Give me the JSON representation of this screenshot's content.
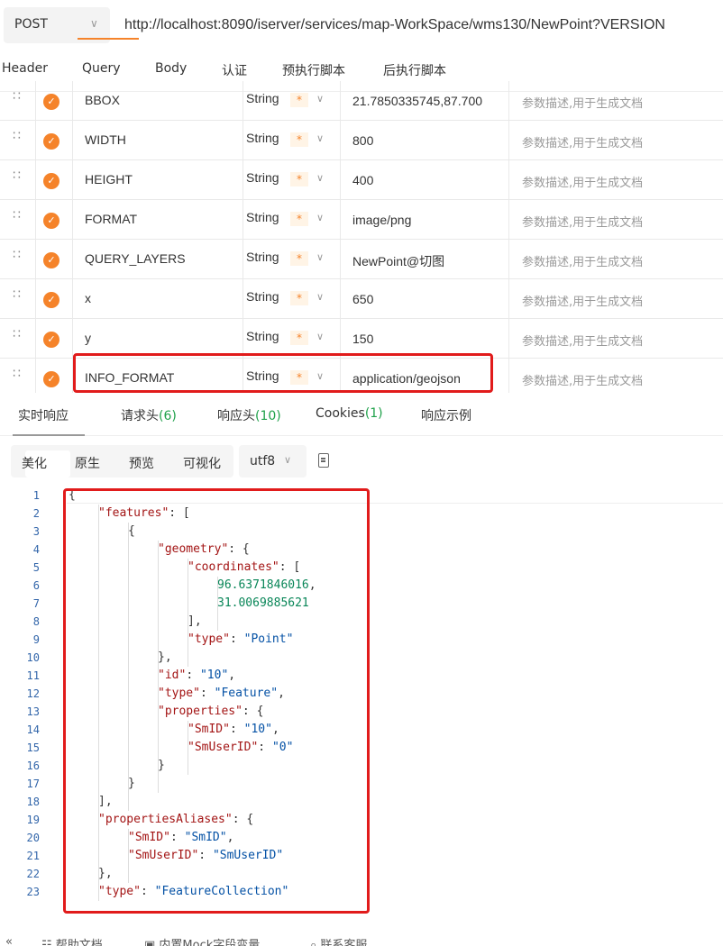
{
  "request": {
    "method": "POST",
    "url": "http://localhost:8090/iserver/services/map-WorkSpace/wms130/NewPoint?VERSION"
  },
  "request_tabs": [
    "Header",
    "Query",
    "Body",
    "认证",
    "预执行脚本",
    "后执行脚本"
  ],
  "active_request_tab": "Query",
  "params": [
    {
      "key": "BBOX",
      "type": "String",
      "required": "*",
      "value": "21.7850335745,87.700",
      "description": "参数描述,用于生成文档"
    },
    {
      "key": "WIDTH",
      "type": "String",
      "required": "*",
      "value": "800",
      "description": "参数描述,用于生成文档"
    },
    {
      "key": "HEIGHT",
      "type": "String",
      "required": "*",
      "value": "400",
      "description": "参数描述,用于生成文档"
    },
    {
      "key": "FORMAT",
      "type": "String",
      "required": "*",
      "value": "image/png",
      "description": "参数描述,用于生成文档"
    },
    {
      "key": "QUERY_LAYERS",
      "type": "String",
      "required": "*",
      "value": "NewPoint@切图",
      "description": "参数描述,用于生成文档"
    },
    {
      "key": "x",
      "type": "String",
      "required": "*",
      "value": "650",
      "description": "参数描述,用于生成文档"
    },
    {
      "key": "y",
      "type": "String",
      "required": "*",
      "value": "150",
      "description": "参数描述,用于生成文档"
    },
    {
      "key": "INFO_FORMAT",
      "type": "String",
      "required": "*",
      "value": "application/geojson",
      "description": "参数描述,用于生成文档"
    }
  ],
  "response_tabs": [
    {
      "label": "实时响应",
      "count": ""
    },
    {
      "label": "请求头",
      "count": "(6)"
    },
    {
      "label": "响应头",
      "count": "(10)"
    },
    {
      "label": "Cookies",
      "count": "(1)"
    },
    {
      "label": "响应示例",
      "count": ""
    }
  ],
  "view_modes": [
    "美化",
    "原生",
    "预览",
    "可视化"
  ],
  "encoding": "utf8",
  "code_lines": [
    {
      "n": "1",
      "indent": 0,
      "parts": [
        [
          "p",
          "{"
        ]
      ]
    },
    {
      "n": "2",
      "indent": 1,
      "parts": [
        [
          "k",
          "\"features\""
        ],
        [
          "p",
          ": ["
        ]
      ]
    },
    {
      "n": "3",
      "indent": 2,
      "parts": [
        [
          "p",
          "{"
        ]
      ]
    },
    {
      "n": "4",
      "indent": 3,
      "parts": [
        [
          "k",
          "\"geometry\""
        ],
        [
          "p",
          ": {"
        ]
      ]
    },
    {
      "n": "5",
      "indent": 4,
      "parts": [
        [
          "k",
          "\"coordinates\""
        ],
        [
          "p",
          ": ["
        ]
      ]
    },
    {
      "n": "6",
      "indent": 5,
      "parts": [
        [
          "n",
          "96.6371846016"
        ],
        [
          "p",
          ","
        ]
      ]
    },
    {
      "n": "7",
      "indent": 5,
      "parts": [
        [
          "n",
          "31.0069885621"
        ]
      ]
    },
    {
      "n": "8",
      "indent": 4,
      "parts": [
        [
          "p",
          "],"
        ]
      ]
    },
    {
      "n": "9",
      "indent": 4,
      "parts": [
        [
          "k",
          "\"type\""
        ],
        [
          "p",
          ": "
        ],
        [
          "s",
          "\"Point\""
        ]
      ]
    },
    {
      "n": "10",
      "indent": 3,
      "parts": [
        [
          "p",
          "},"
        ]
      ]
    },
    {
      "n": "11",
      "indent": 3,
      "parts": [
        [
          "k",
          "\"id\""
        ],
        [
          "p",
          ": "
        ],
        [
          "s",
          "\"10\""
        ],
        [
          "p",
          ","
        ]
      ]
    },
    {
      "n": "12",
      "indent": 3,
      "parts": [
        [
          "k",
          "\"type\""
        ],
        [
          "p",
          ": "
        ],
        [
          "s",
          "\"Feature\""
        ],
        [
          "p",
          ","
        ]
      ]
    },
    {
      "n": "13",
      "indent": 3,
      "parts": [
        [
          "k",
          "\"properties\""
        ],
        [
          "p",
          ": {"
        ]
      ]
    },
    {
      "n": "14",
      "indent": 4,
      "parts": [
        [
          "k",
          "\"SmID\""
        ],
        [
          "p",
          ": "
        ],
        [
          "s",
          "\"10\""
        ],
        [
          "p",
          ","
        ]
      ]
    },
    {
      "n": "15",
      "indent": 4,
      "parts": [
        [
          "k",
          "\"SmUserID\""
        ],
        [
          "p",
          ": "
        ],
        [
          "s",
          "\"0\""
        ]
      ]
    },
    {
      "n": "16",
      "indent": 3,
      "parts": [
        [
          "p",
          "}"
        ]
      ]
    },
    {
      "n": "17",
      "indent": 2,
      "parts": [
        [
          "p",
          "}"
        ]
      ]
    },
    {
      "n": "18",
      "indent": 1,
      "parts": [
        [
          "p",
          "],"
        ]
      ]
    },
    {
      "n": "19",
      "indent": 1,
      "parts": [
        [
          "k",
          "\"propertiesAliases\""
        ],
        [
          "p",
          ": {"
        ]
      ]
    },
    {
      "n": "20",
      "indent": 2,
      "parts": [
        [
          "k",
          "\"SmID\""
        ],
        [
          "p",
          ": "
        ],
        [
          "s",
          "\"SmID\""
        ],
        [
          "p",
          ","
        ]
      ]
    },
    {
      "n": "21",
      "indent": 2,
      "parts": [
        [
          "k",
          "\"SmUserID\""
        ],
        [
          "p",
          ": "
        ],
        [
          "s",
          "\"SmUserID\""
        ]
      ]
    },
    {
      "n": "22",
      "indent": 1,
      "parts": [
        [
          "p",
          "},"
        ]
      ]
    },
    {
      "n": "23",
      "indent": 1,
      "parts": [
        [
          "k",
          "\"type\""
        ],
        [
          "p",
          ": "
        ],
        [
          "s",
          "\"FeatureCollection\""
        ]
      ]
    }
  ],
  "footer": {
    "collapse": "«",
    "items": [
      "帮助文档",
      "内置Mock字段变量",
      "联系客服"
    ]
  },
  "colors": {
    "accent": "#f5832a",
    "highlight": "#e11b1b",
    "json_key": "#a31515",
    "json_string": "#0451a5",
    "json_number": "#098658",
    "count_green": "#1fa14a"
  }
}
